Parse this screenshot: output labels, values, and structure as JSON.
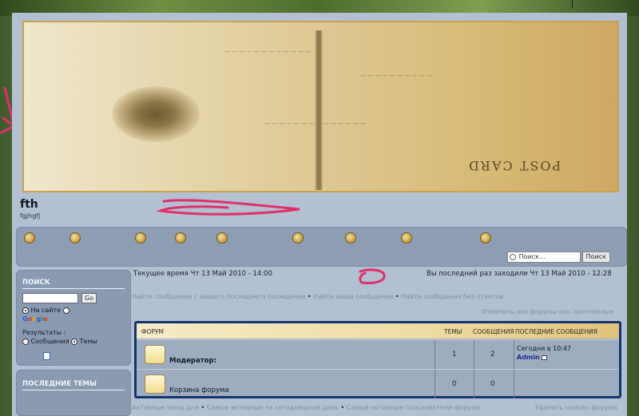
{
  "site": {
    "title": "fth",
    "description": "fgjhgfj"
  },
  "banner": {
    "post_card": "POST CARD"
  },
  "header_search": {
    "placeholder": "Поиск...",
    "button": "Поиск"
  },
  "sidebar": {
    "search_title": "ПОИСК",
    "go_label": "Go",
    "on_site_label": "На сайте",
    "google_label": "Google",
    "results_label": "Результаты :",
    "messages_label": "Сообщения",
    "topics_label": "Темы",
    "recent_title": "ПОСЛЕДНИЕ ТЕМЫ"
  },
  "main": {
    "current_time": "Текущее время Чт 13 Май 2010 - 14:00",
    "last_visit": "Вы последний раз заходили Чт 13 Май 2010 - 12:28",
    "search_links": [
      "Найти сообщения с вашего последнего посещения",
      "Найти ваши сообщения",
      "Найти сообщения без ответов"
    ],
    "mark_read": "Отметить все форумы как прочтенные"
  },
  "forum_table": {
    "headers": {
      "forum": "ФОРУМ",
      "topics": "ТЕМЫ",
      "posts": "СООБЩЕНИЯ",
      "last": "ПОСЛЕДНИЕ СООБЩЕНИЯ"
    },
    "rows": [
      {
        "name": "Модератор:",
        "topics": "1",
        "posts": "2",
        "last_date": "Сегодня в 10:47",
        "last_user": "Admin"
      },
      {
        "name": "Корзина форума",
        "topics": "0",
        "posts": "0",
        "last_date": "",
        "last_user": ""
      }
    ]
  },
  "footer": {
    "links": [
      "Активные темы дня",
      "Самые активные за сегодняшний день",
      "Самые активные пользователи форума"
    ],
    "cookies": "Удалить cookies форума"
  },
  "colors": {
    "page_bg": "#b2c0d2",
    "panel": "#8a9ab0",
    "table_border": "#14356f",
    "annotation": "#e0306a"
  }
}
